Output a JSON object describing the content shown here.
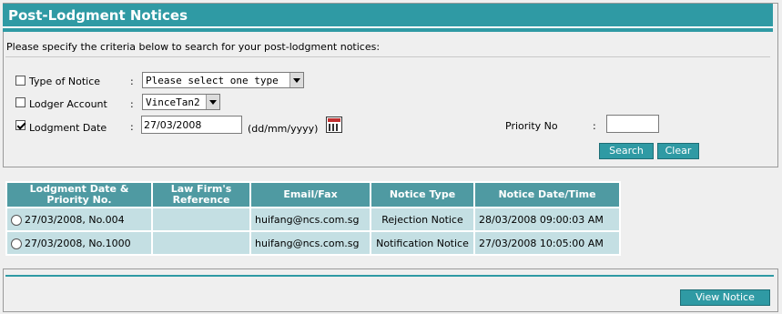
{
  "title": "Post-Lodgment Notices",
  "instruction": "Please specify the criteria below to search for your post-lodgment notices:",
  "criteria": {
    "notice_type": {
      "label": "Type of Notice",
      "colon": ":",
      "checked": false,
      "value": "Please select one type"
    },
    "lodger_account": {
      "label": "Lodger Account",
      "colon": ":",
      "checked": false,
      "value": "VinceTan2"
    },
    "lodgment_date": {
      "label": "Lodgment Date",
      "colon": ":",
      "checked": true,
      "value": "27/03/2008",
      "format_hint": "(dd/mm/yyyy)"
    },
    "priority_no": {
      "label": "Priority No",
      "colon": ":",
      "value": ""
    }
  },
  "buttons": {
    "search": "Search",
    "clear": "Clear",
    "view_notice": "View Notice"
  },
  "table": {
    "headers": {
      "date_line1": "Lodgment Date &",
      "date_line2": "Priority No.",
      "ref_line1": "Law Firm's",
      "ref_line2": "Reference",
      "email": "Email/Fax",
      "type": "Notice Type",
      "notice_date": "Notice Date/Time"
    },
    "rows": [
      {
        "date_priority": "27/03/2008, No.004",
        "reference": "",
        "email": "huifang@ncs.com.sg",
        "type": "Rejection Notice",
        "notice_date": "28/03/2008 09:00:03 AM"
      },
      {
        "date_priority": "27/03/2008, No.1000",
        "reference": "",
        "email": "huifang@ncs.com.sg",
        "type": "Notification Notice",
        "notice_date": "27/03/2008 10:05:00 AM"
      }
    ]
  },
  "colors": {
    "accent": "#2f9aa4",
    "header": "#4f9aa2",
    "cell": "#c4dfe3",
    "background": "#efefef"
  }
}
